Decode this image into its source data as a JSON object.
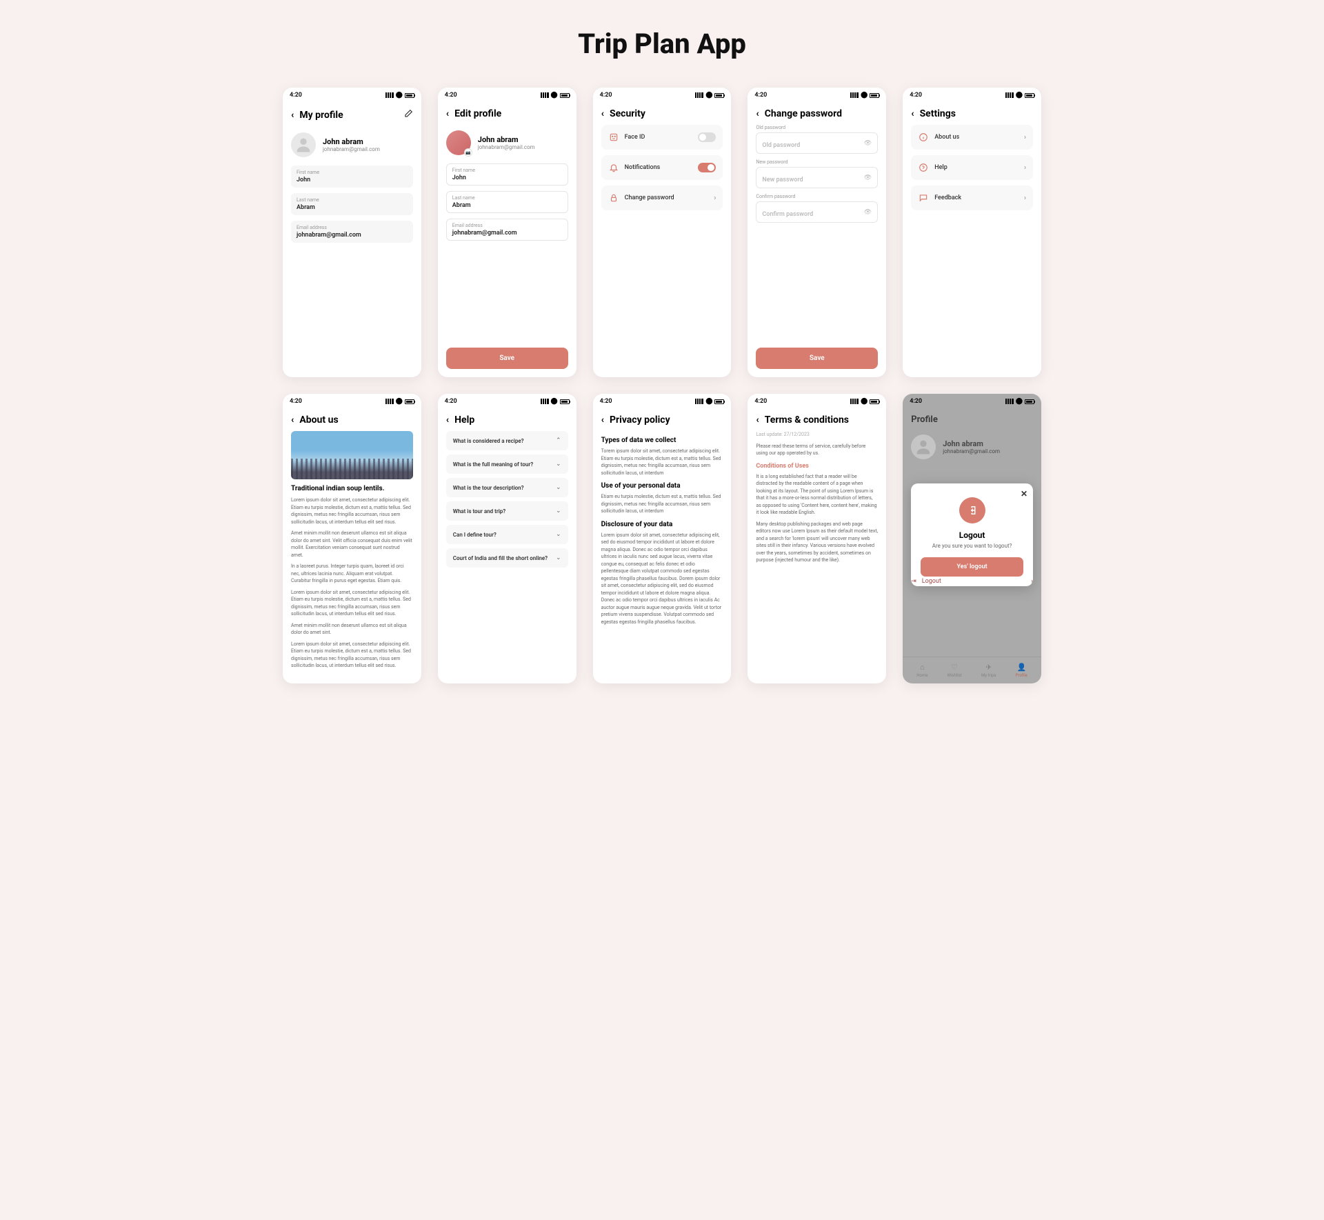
{
  "page_title": "Trip Plan App",
  "statusbar": {
    "time": "4:20"
  },
  "screens": {
    "my_profile": {
      "title": "My profile",
      "name": "John abram",
      "email": "johnabram@gmail.com",
      "fields": {
        "first_name_label": "First name",
        "first_name": "John",
        "last_name_label": "Last name",
        "last_name": "Abram",
        "email_label": "Email address",
        "email_val": "johnabram@gmail.com"
      }
    },
    "edit_profile": {
      "title": "Edit profile",
      "name": "John abram",
      "email": "johnabram@gmail.com",
      "fields": {
        "first_name_label": "First name",
        "first_name": "John",
        "last_name_label": "Last name",
        "last_name": "Abram",
        "email_label": "Email address",
        "email_val": "johnabram@gmail.com"
      },
      "save_btn": "Save"
    },
    "security": {
      "title": "Security",
      "face_id": "Face ID",
      "notifications": "Notifications",
      "change_password": "Change password"
    },
    "change_password": {
      "title": "Change password",
      "old_label": "Old password",
      "old_placeholder": "Old password",
      "new_label": "New password",
      "new_placeholder": "New password",
      "confirm_label": "Confirm password",
      "confirm_placeholder": "Confirm password",
      "save_btn": "Save"
    },
    "settings": {
      "title": "Settings",
      "about": "About us",
      "help": "Help",
      "feedback": "Feedback"
    },
    "about": {
      "title": "About us",
      "heading": "Traditional indian soup lentils.",
      "p1": "Lorem ipsum dolor sit amet, consectetur adipiscing elit. Etiam eu turpis molestie, dictum est a, mattis tellus. Sed dignissim, metus nec fringilla accumsan, risus sem sollicitudin lacus, ut interdum tellus elit sed risus.",
      "p2": "Amet minim mollit non deserunt ullamco est sit aliqua dolor do amet sint. Velit officia consequat duis enim velit mollit. Exercitation veniam consequat sunt nostrud amet.",
      "p3": "In a laoreet purus. Integer turpis quam, laoreet id orci nec, ultrices lacinia nunc. Aliquam erat volutpat. Curabitur fringilla in purus eget egestas. Etiam quis.",
      "p4": "Lorem ipsum dolor sit amet, consectetur adipiscing elit. Etiam eu turpis molestie, dictum est a, mattis tellus. Sed dignissim, metus nec fringilla accumsan, risus sem sollicitudin lacus, ut interdum tellus elit sed risus.",
      "p5": "Amet minim mollit non deserunt ullamco est sit aliqua dolor do amet sint.",
      "p6": "Lorem ipsum dolor sit amet, consectetur adipiscing elit. Etiam eu turpis molestie, dictum est a, mattis tellus. Sed dignissim, metus nec fringilla accumsan, risus sem sollicitudin lacus, ut interdum tellus elit sed risus."
    },
    "help": {
      "title": "Help",
      "q1": "What is considered a recipe?",
      "q2": "What is the full meaning of tour?",
      "q3": "What is the tour description?",
      "q4": "What is tour and trip?",
      "q5": "Can I define tour?",
      "q6": "Court of India and fill the short online?"
    },
    "privacy": {
      "title": "Privacy policy",
      "h1": "Types of data we collect",
      "p1": "Torem ipsum dolor sit amet, consectetur adipiscing elit. Etiam eu turpis molestie, dictum est a, mattis tellus. Sed dignissim, metus nec fringilla accumsan, risus sem sollicitudin lacus, ut interdum",
      "h2": "Use of your personal data",
      "p2": "Etiam eu turpis molestie, dictum est a, mattis tellus. Sed dignissim, metus nec fringilla accumsan, risus sem sollicitudin lacus, ut interdum",
      "h3": "Disclosure of your data",
      "p3": "Lorem ipsum dolor sit amet, consectetur adipiscing elit, sed do eiusmod tempor incididunt ut labore et dolore magna aliqua. Donec ac odio tempor orci dapibus ultrices in iaculis nunc sed augue lacus, viverra vitae congue eu, consequat ac felis donec et odio pellentesque diam volutpat commodo sed egestas egestas fringilla phasellus faucibus. Dorem ipsum dolor sit amet, consectetur adipiscing elit, sed do eiusmod tempor incididunt ut labore et dolore magna aliqua. Donec ac odio tempor orci dapibus ultrices in iaculis Ac auctor augue mauris augue neque gravida. Velit ut tortor pretium viverra suspendisse. Volutpat commodo sed egestas egestas fringilla phasellus faucibus."
    },
    "terms": {
      "title": "Terms & conditions",
      "updated": "Last update: 27/12/2023",
      "intro": "Please read these terms of service, carefully before using our app operated by us.",
      "cond_h": "Conditions of Uses",
      "cond_p1": "It is a long established fact that a reader will be distracted by the readable content of a page when looking at its layout. The point of using Lorem Ipsum is that it has a more-or-less normal distribution of letters, as opposed to using 'Content here, content here', making it look like readable English.",
      "cond_p2": "Many desktop publishing packages and web page editors now use Lorem Ipsum as their default model text, and a search for 'lorem ipsum' will uncover many web sites still in their infancy. Various versions have evolved over the years, sometimes by accident, sometimes on purpose (injected humour and the like)."
    },
    "logout": {
      "header": "Profile",
      "name": "John abram",
      "email": "johnabram@gmail.com",
      "modal_title": "Logout",
      "modal_sub": "Are you sure you want to logout?",
      "modal_btn": "Yes' logout",
      "row_logout": "Logout",
      "tabs": {
        "home": "Home",
        "wishlist": "Wishlist",
        "trips": "My trips",
        "profile": "Profile"
      }
    }
  }
}
